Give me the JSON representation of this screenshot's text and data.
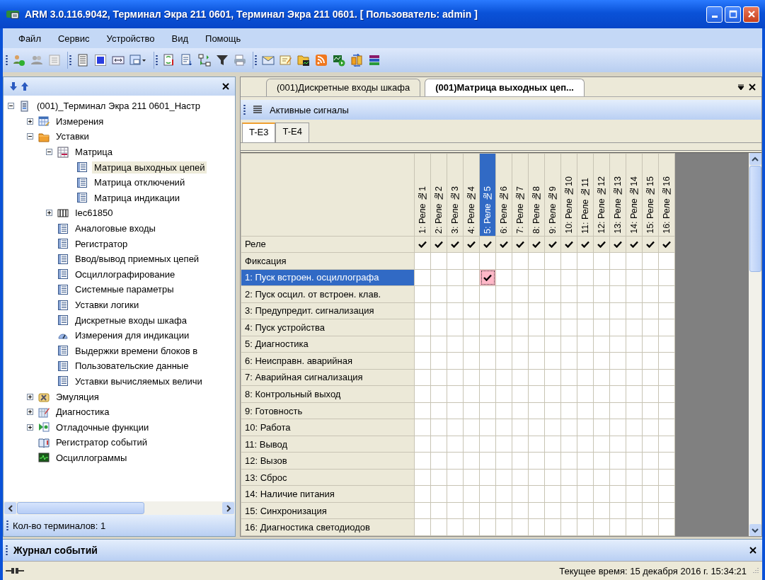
{
  "window": {
    "title": "ARM 3.0.116.9042, Терминал Экра 211 0601, Терминал Экра 211 0601. [ Пользователь: admin ]"
  },
  "menu": [
    "Файл",
    "Сервис",
    "Устройство",
    "Вид",
    "Помощь"
  ],
  "tree": [
    {
      "label": "(001)_Терминал Экра 211 0601_Настр",
      "kind": "terminal",
      "expanded": true,
      "selected": false,
      "children": [
        {
          "label": "Измерения",
          "kind": "measure",
          "expanded": false,
          "selected": false
        },
        {
          "label": "Уставки",
          "kind": "folder",
          "expanded": true,
          "selected": false,
          "children": [
            {
              "label": "Матрица",
              "kind": "matrix",
              "expanded": true,
              "selected": false,
              "children": [
                {
                  "label": "Матрица выходных цепей",
                  "kind": "table",
                  "selected": true
                },
                {
                  "label": "Матрица отключений",
                  "kind": "table",
                  "selected": false
                },
                {
                  "label": "Матрица индикации",
                  "kind": "table",
                  "selected": false
                }
              ]
            },
            {
              "label": "Iec61850",
              "kind": "iec",
              "expanded": false,
              "selected": false
            },
            {
              "label": "Аналоговые входы",
              "kind": "table",
              "selected": false
            },
            {
              "label": "Регистратор",
              "kind": "table",
              "selected": false
            },
            {
              "label": "Ввод/вывод приемных цепей",
              "kind": "table",
              "selected": false
            },
            {
              "label": "Осциллографирование",
              "kind": "table",
              "selected": false
            },
            {
              "label": "Системные параметры",
              "kind": "table",
              "selected": false
            },
            {
              "label": "Уставки логики",
              "kind": "table",
              "selected": false
            },
            {
              "label": "Дискретные входы шкафа",
              "kind": "table",
              "selected": false
            },
            {
              "label": "Измерения для индикации",
              "kind": "meter",
              "selected": false
            },
            {
              "label": "Выдержки времени блоков в",
              "kind": "table",
              "selected": false
            },
            {
              "label": "Пользовательские данные",
              "kind": "table",
              "selected": false
            },
            {
              "label": "Уставки вычисляемых величи",
              "kind": "table",
              "selected": false
            }
          ]
        },
        {
          "label": "Эмуляция",
          "kind": "emulation",
          "expanded": false,
          "selected": false
        },
        {
          "label": "Диагностика",
          "kind": "diagnostics",
          "expanded": false,
          "selected": false
        },
        {
          "label": "Отладочные функции",
          "kind": "debug",
          "expanded": false,
          "selected": false
        },
        {
          "label": "Регистратор событий",
          "kind": "book",
          "selected": false
        },
        {
          "label": "Осциллограммы",
          "kind": "scope",
          "selected": false
        }
      ]
    }
  ],
  "left_footer": "Кол-во терминалов: 1",
  "doc_tabs": [
    {
      "label": "(001)Дискретные входы шкафа",
      "selected": false
    },
    {
      "label": "(001)Матрица выходных цеп...",
      "selected": true
    }
  ],
  "panel_toolbar": "Активные сигналы",
  "sub_tabs": [
    {
      "label": "T-E3",
      "selected": true
    },
    {
      "label": "T-E4",
      "selected": false
    }
  ],
  "matrix": {
    "columns": [
      {
        "label": "1: Реле №1",
        "selected": false
      },
      {
        "label": "2: Реле №2",
        "selected": false
      },
      {
        "label": "3: Реле №3",
        "selected": false
      },
      {
        "label": "4: Реле №4",
        "selected": false
      },
      {
        "label": "5: Реле №5",
        "selected": true
      },
      {
        "label": "6: Реле №6",
        "selected": false
      },
      {
        "label": "7: Реле №7",
        "selected": false
      },
      {
        "label": "8: Реле №8",
        "selected": false
      },
      {
        "label": "9: Реле №9",
        "selected": false
      },
      {
        "label": "10: Реле №10",
        "selected": false
      },
      {
        "label": "11: Реле №11",
        "selected": false
      },
      {
        "label": "12: Реле №12",
        "selected": false
      },
      {
        "label": "13: Реле №13",
        "selected": false
      },
      {
        "label": "14: Реле №14",
        "selected": false
      },
      {
        "label": "15: Реле №15",
        "selected": false
      },
      {
        "label": "16: Реле №16",
        "selected": false
      }
    ],
    "relay_row": {
      "label": "Реле",
      "checks": [
        true,
        true,
        true,
        true,
        true,
        true,
        true,
        true,
        true,
        true,
        true,
        true,
        true,
        true,
        true,
        true
      ]
    },
    "rows": [
      {
        "label": "Фиксация",
        "selected": false,
        "cells": [
          false,
          false,
          false,
          false,
          false,
          false,
          false,
          false,
          false,
          false,
          false,
          false,
          false,
          false,
          false,
          false
        ]
      },
      {
        "label": "1: Пуск встроен. осциллографа",
        "selected": true,
        "cells": [
          false,
          false,
          false,
          false,
          true,
          false,
          false,
          false,
          false,
          false,
          false,
          false,
          false,
          false,
          false,
          false
        ]
      },
      {
        "label": "2: Пуск осцил. от встроен. клав.",
        "selected": false,
        "cells": [
          false,
          false,
          false,
          false,
          false,
          false,
          false,
          false,
          false,
          false,
          false,
          false,
          false,
          false,
          false,
          false
        ]
      },
      {
        "label": "3: Предупредит. сигнализация",
        "selected": false,
        "cells": [
          false,
          false,
          false,
          false,
          false,
          false,
          false,
          false,
          false,
          false,
          false,
          false,
          false,
          false,
          false,
          false
        ]
      },
      {
        "label": "4: Пуск устройства",
        "selected": false,
        "cells": [
          false,
          false,
          false,
          false,
          false,
          false,
          false,
          false,
          false,
          false,
          false,
          false,
          false,
          false,
          false,
          false
        ]
      },
      {
        "label": "5: Диагностика",
        "selected": false,
        "cells": [
          false,
          false,
          false,
          false,
          false,
          false,
          false,
          false,
          false,
          false,
          false,
          false,
          false,
          false,
          false,
          false
        ]
      },
      {
        "label": "6: Неисправн. аварийная",
        "selected": false,
        "cells": [
          false,
          false,
          false,
          false,
          false,
          false,
          false,
          false,
          false,
          false,
          false,
          false,
          false,
          false,
          false,
          false
        ]
      },
      {
        "label": "7: Аварийная сигнализация",
        "selected": false,
        "cells": [
          false,
          false,
          false,
          false,
          false,
          false,
          false,
          false,
          false,
          false,
          false,
          false,
          false,
          false,
          false,
          false
        ]
      },
      {
        "label": "8: Контрольный выход",
        "selected": false,
        "cells": [
          false,
          false,
          false,
          false,
          false,
          false,
          false,
          false,
          false,
          false,
          false,
          false,
          false,
          false,
          false,
          false
        ]
      },
      {
        "label": "9: Готовность",
        "selected": false,
        "cells": [
          false,
          false,
          false,
          false,
          false,
          false,
          false,
          false,
          false,
          false,
          false,
          false,
          false,
          false,
          false,
          false
        ]
      },
      {
        "label": "10: Работа",
        "selected": false,
        "cells": [
          false,
          false,
          false,
          false,
          false,
          false,
          false,
          false,
          false,
          false,
          false,
          false,
          false,
          false,
          false,
          false
        ]
      },
      {
        "label": "11: Вывод",
        "selected": false,
        "cells": [
          false,
          false,
          false,
          false,
          false,
          false,
          false,
          false,
          false,
          false,
          false,
          false,
          false,
          false,
          false,
          false
        ]
      },
      {
        "label": "12: Вызов",
        "selected": false,
        "cells": [
          false,
          false,
          false,
          false,
          false,
          false,
          false,
          false,
          false,
          false,
          false,
          false,
          false,
          false,
          false,
          false
        ]
      },
      {
        "label": "13: Сброс",
        "selected": false,
        "cells": [
          false,
          false,
          false,
          false,
          false,
          false,
          false,
          false,
          false,
          false,
          false,
          false,
          false,
          false,
          false,
          false
        ]
      },
      {
        "label": "14: Наличие питания",
        "selected": false,
        "cells": [
          false,
          false,
          false,
          false,
          false,
          false,
          false,
          false,
          false,
          false,
          false,
          false,
          false,
          false,
          false,
          false
        ]
      },
      {
        "label": "15: Синхронизация",
        "selected": false,
        "cells": [
          false,
          false,
          false,
          false,
          false,
          false,
          false,
          false,
          false,
          false,
          false,
          false,
          false,
          false,
          false,
          false
        ]
      },
      {
        "label": "16: Диагностика светодиодов",
        "selected": false,
        "cells": [
          false,
          false,
          false,
          false,
          false,
          false,
          false,
          false,
          false,
          false,
          false,
          false,
          false,
          false,
          false,
          false
        ]
      }
    ]
  },
  "event_log": {
    "title": "Журнал событий"
  },
  "status_bar": {
    "time": "Текущее время: 15 декабря 2016 г. 15:34:21"
  }
}
